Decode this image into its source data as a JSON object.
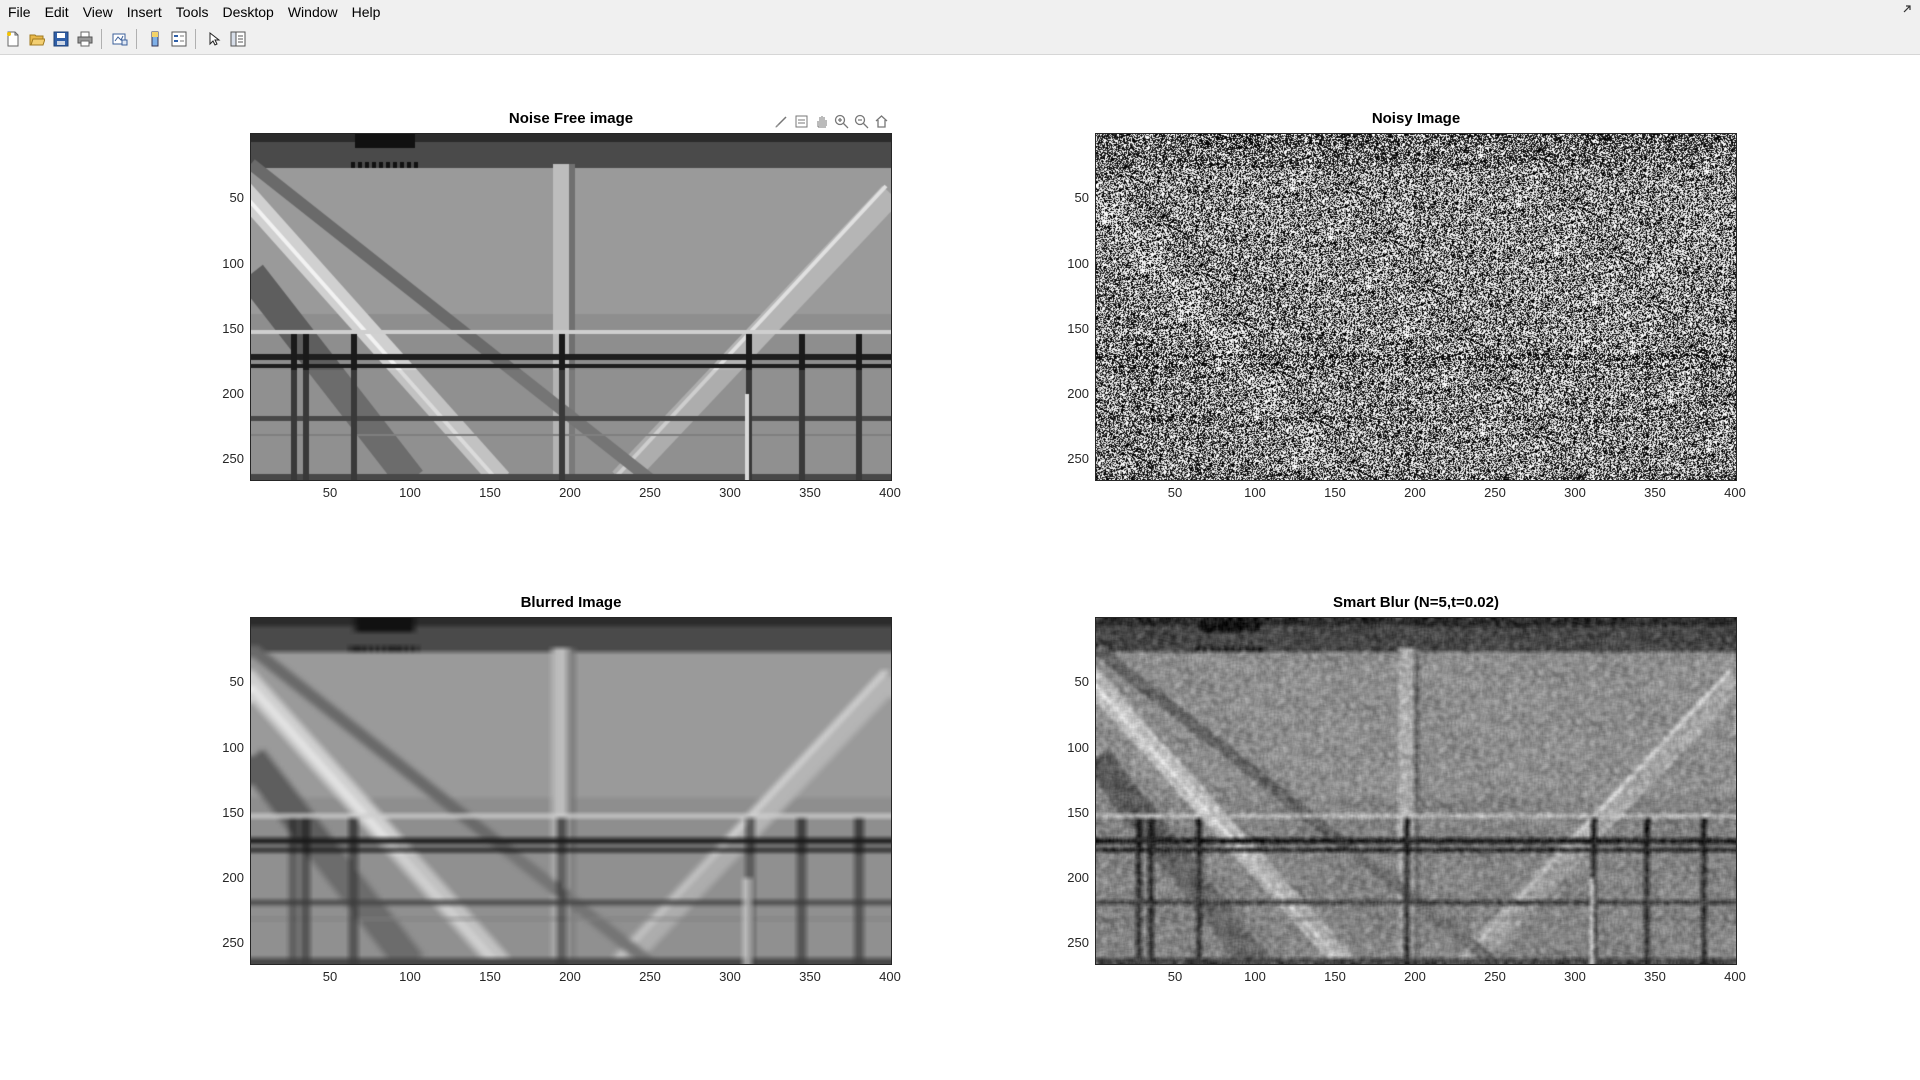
{
  "menubar": {
    "items": [
      {
        "label": "File",
        "name": "menu-file"
      },
      {
        "label": "Edit",
        "name": "menu-edit"
      },
      {
        "label": "View",
        "name": "menu-view"
      },
      {
        "label": "Insert",
        "name": "menu-insert"
      },
      {
        "label": "Tools",
        "name": "menu-tools"
      },
      {
        "label": "Desktop",
        "name": "menu-desktop"
      },
      {
        "label": "Window",
        "name": "menu-window"
      },
      {
        "label": "Help",
        "name": "menu-help"
      }
    ],
    "undock_icon": "undock-icon"
  },
  "toolbar": {
    "buttons": [
      "new-figure-icon",
      "open-file-icon",
      "save-icon",
      "print-icon",
      "link-plot-icon",
      "insert-colorbar-icon",
      "insert-legend-icon",
      "edit-plot-icon",
      "property-inspector-icon"
    ]
  },
  "axes_toolbar": {
    "icons": [
      "brush-icon",
      "data-tips-icon",
      "pan-icon",
      "zoom-in-icon",
      "zoom-out-icon",
      "restore-view-icon"
    ]
  },
  "subplots": [
    {
      "title": "Noise Free image",
      "image_kind": "clean",
      "y_ticks": [
        "50",
        "100",
        "150",
        "200",
        "250"
      ],
      "x_ticks": [
        "50",
        "100",
        "150",
        "200",
        "250",
        "300",
        "350",
        "400"
      ]
    },
    {
      "title": "Noisy Image",
      "image_kind": "noisy",
      "y_ticks": [
        "50",
        "100",
        "150",
        "200",
        "250"
      ],
      "x_ticks": [
        "50",
        "100",
        "150",
        "200",
        "250",
        "300",
        "350",
        "400"
      ]
    },
    {
      "title": "Blurred Image",
      "image_kind": "blurred",
      "y_ticks": [
        "50",
        "100",
        "150",
        "200",
        "250"
      ],
      "x_ticks": [
        "50",
        "100",
        "150",
        "200",
        "250",
        "300",
        "350",
        "400"
      ]
    },
    {
      "title": "Smart Blur (N=5,t=0.02)",
      "image_kind": "smart",
      "y_ticks": [
        "50",
        "100",
        "150",
        "200",
        "250"
      ],
      "x_ticks": [
        "50",
        "100",
        "150",
        "200",
        "250",
        "300",
        "350",
        "400"
      ]
    }
  ],
  "colors": {
    "menubar_bg": "#f0f0f0",
    "axes_color": "#262626",
    "sky_gray": "#8f8f8f",
    "beam_dark": "#2a2a2a"
  }
}
